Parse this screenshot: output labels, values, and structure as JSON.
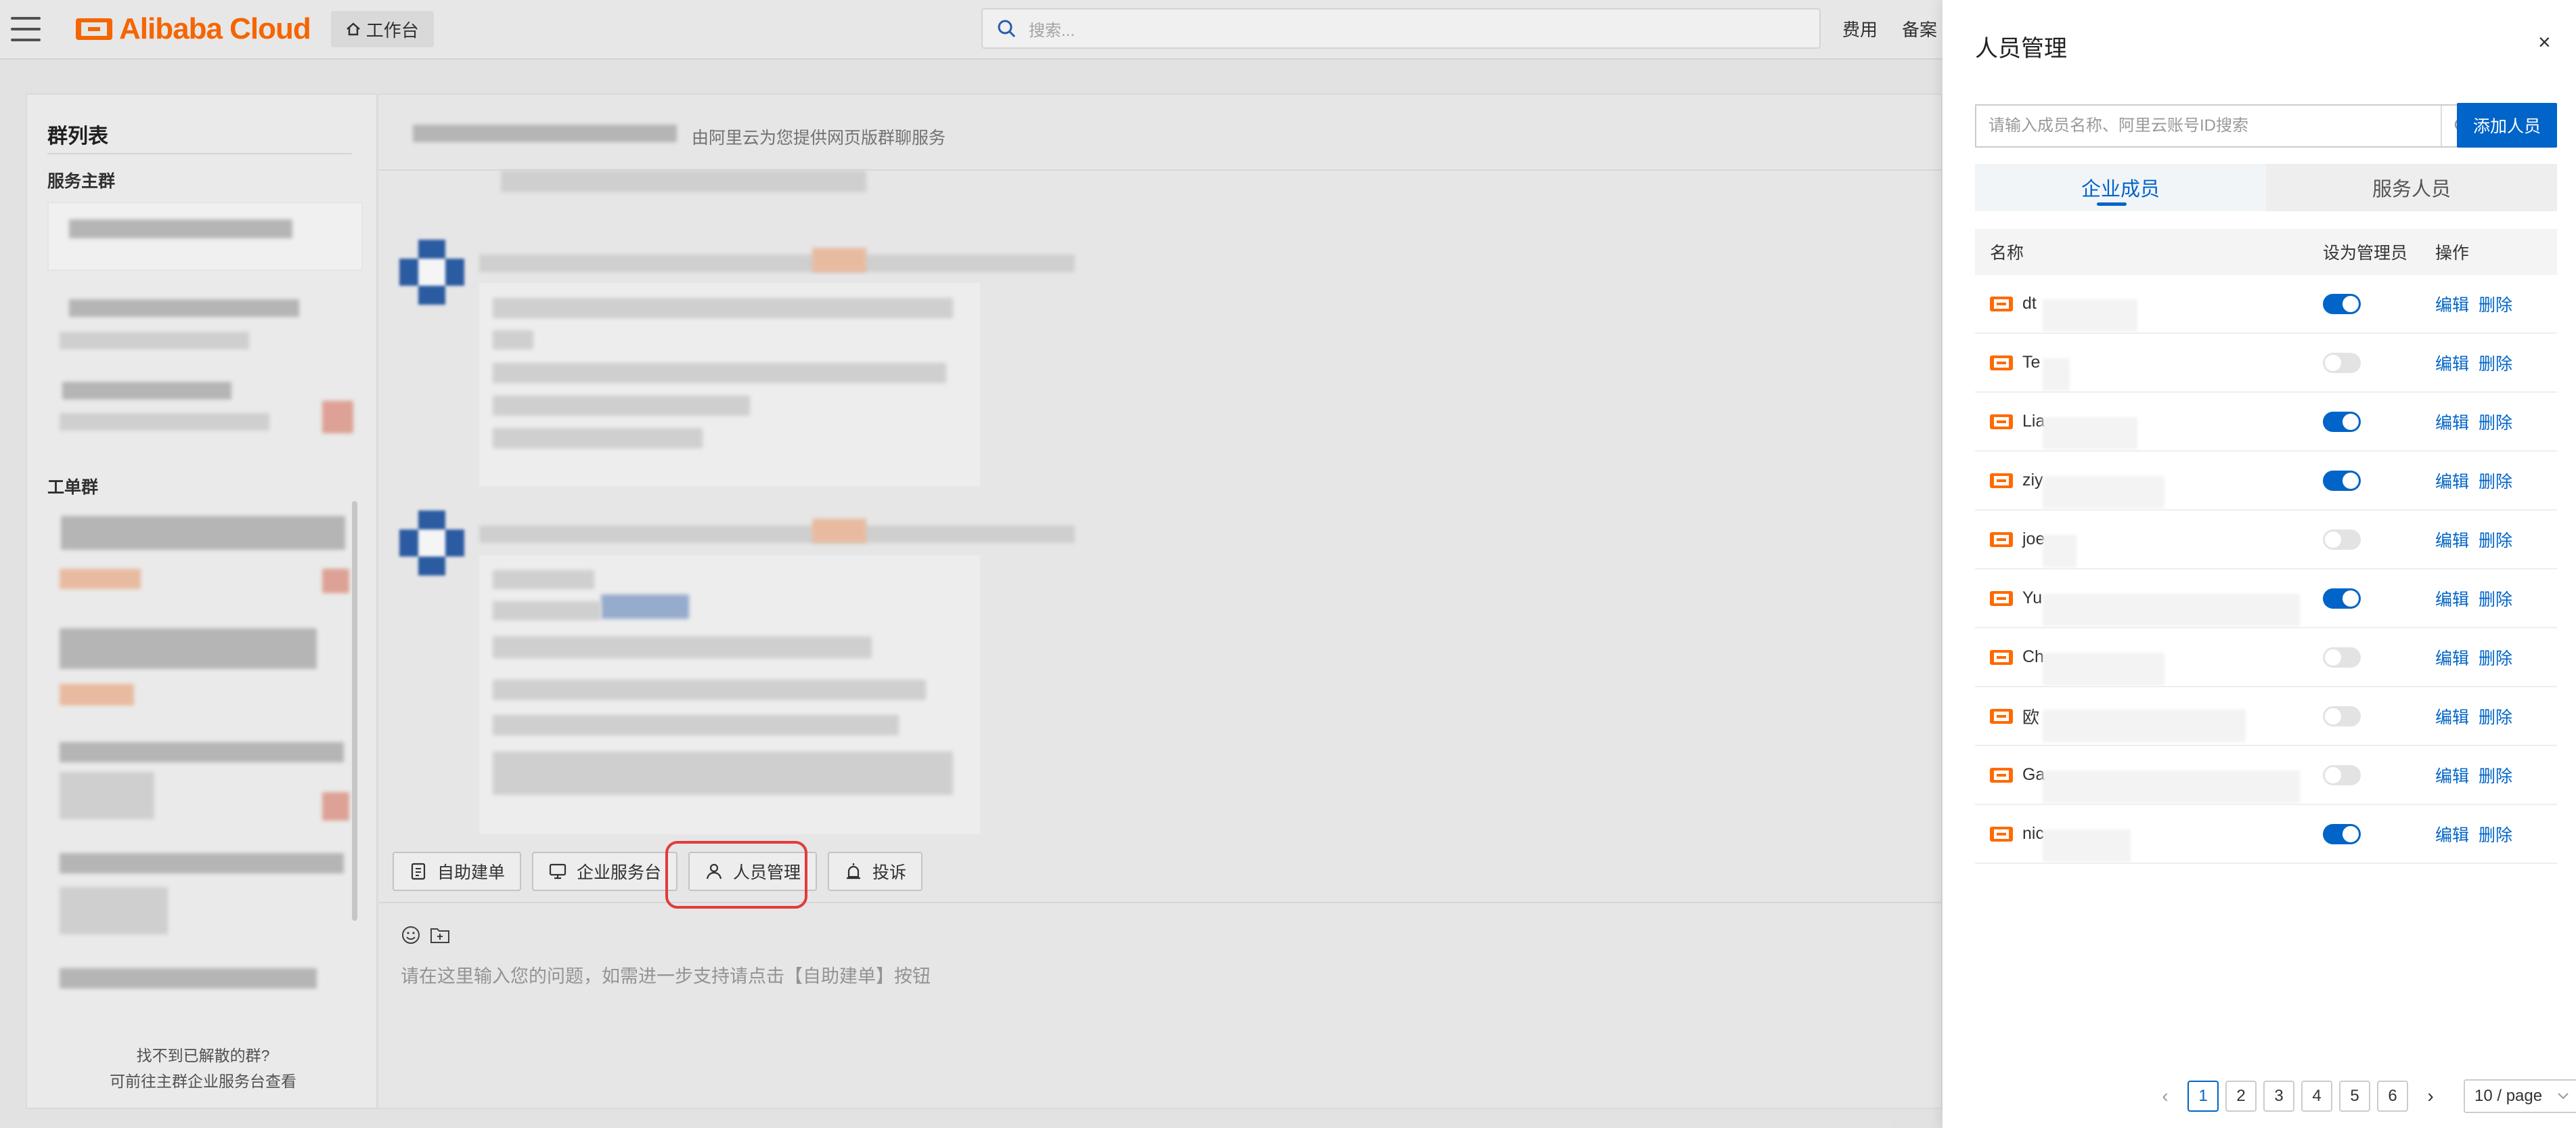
{
  "topbar": {
    "brand": "Alibaba Cloud",
    "workbench": "工作台",
    "search_placeholder": "搜索...",
    "nav": [
      "费用",
      "备案"
    ]
  },
  "left_panel": {
    "title": "群列表",
    "service_main_group": "服务主群",
    "ticket_group": "工单群",
    "footer_line1": "找不到已解散的群?",
    "footer_line2": "可前往主群企业服务台查看"
  },
  "chat": {
    "header_hint": "由阿里云为您提供网页版群聊服务",
    "actions": {
      "self_ticket": "自助建单",
      "service_desk": "企业服务台",
      "member_mgmt": "人员管理",
      "complaint": "投诉"
    },
    "input_placeholder": "请在这里输入您的问题，如需进一步支持请点击【自助建单】按钮"
  },
  "drawer": {
    "title": "人员管理",
    "close": "×",
    "search_placeholder": "请输入成员名称、阿里云账号ID搜索",
    "add_button": "添加人员",
    "tabs": [
      "企业成员",
      "服务人员"
    ],
    "active_tab": 0,
    "columns": [
      "名称",
      "设为管理员",
      "操作"
    ],
    "rows": [
      {
        "name": "dt",
        "admin": true
      },
      {
        "name": "Te",
        "admin": false
      },
      {
        "name": "Lia",
        "admin": true
      },
      {
        "name": "ziy",
        "admin": true
      },
      {
        "name": "joe",
        "admin": false
      },
      {
        "name": "Yu",
        "admin": true
      },
      {
        "name": "Ch",
        "admin": false
      },
      {
        "name": "欧",
        "admin": false
      },
      {
        "name": "Ga",
        "admin": false
      },
      {
        "name": "nic",
        "admin": true
      }
    ],
    "row_actions": {
      "edit": "编辑",
      "delete": "删除"
    },
    "pagination": {
      "pages": [
        "1",
        "2",
        "3",
        "4",
        "5",
        "6"
      ],
      "current": "1",
      "page_size": "10 / page"
    }
  },
  "colors": {
    "accent": "#0064c8",
    "brand": "#ff6a00",
    "highlight": "#e23b3b"
  }
}
